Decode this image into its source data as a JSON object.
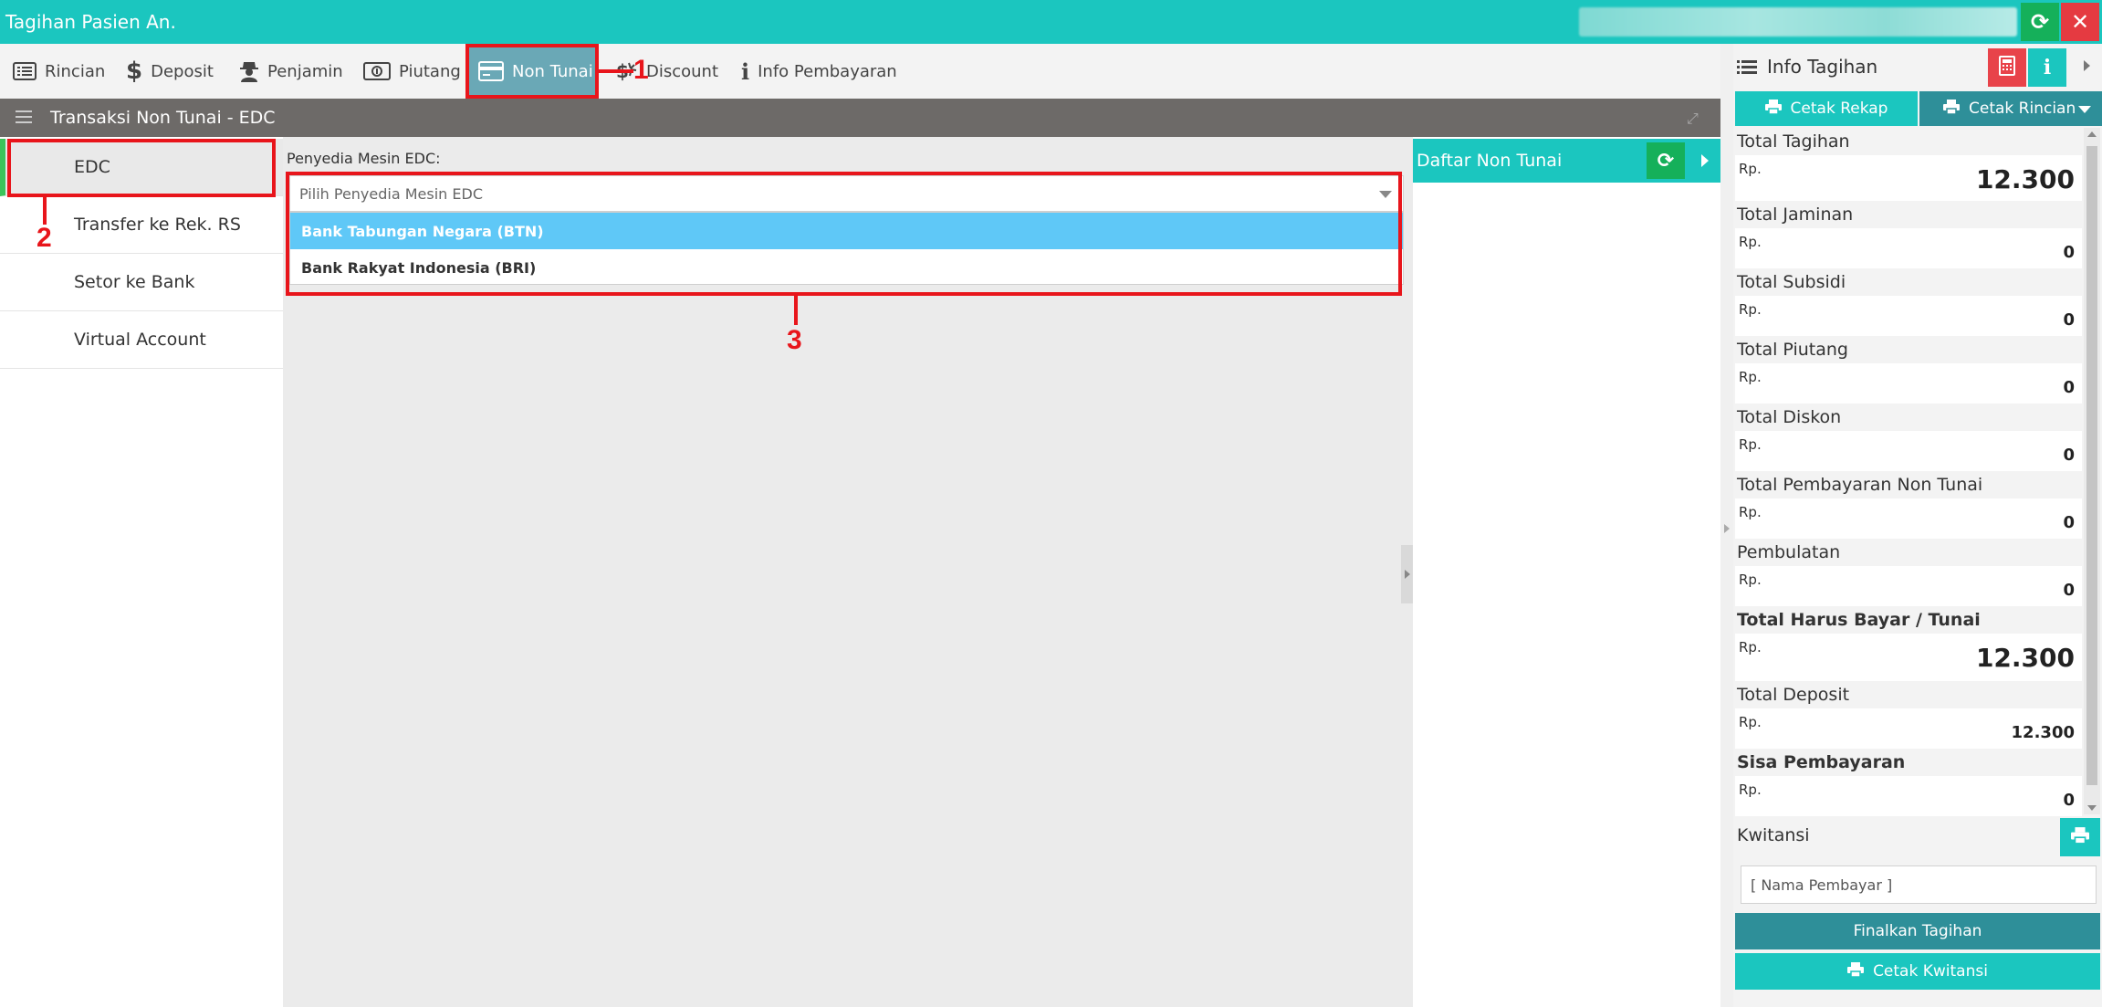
{
  "window": {
    "title": "Tagihan Pasien An."
  },
  "tabs": [
    {
      "label": "Rincian",
      "icon": "list-icon"
    },
    {
      "label": "Deposit",
      "icon": "dollar-icon"
    },
    {
      "label": "Penjamin",
      "icon": "user-secret-icon"
    },
    {
      "label": "Piutang",
      "icon": "money-icon"
    },
    {
      "label": "Non Tunai",
      "icon": "credit-card-icon",
      "active": true
    },
    {
      "label": "Discount",
      "icon": "discount-icon"
    },
    {
      "label": "Info Pembayaran",
      "icon": "info-icon"
    }
  ],
  "section": {
    "title": "Transaksi Non Tunai - EDC"
  },
  "left_menu": [
    {
      "label": "EDC",
      "active": true
    },
    {
      "label": "Transfer ke Rek. RS"
    },
    {
      "label": "Setor ke Bank"
    },
    {
      "label": "Virtual Account"
    }
  ],
  "form": {
    "edc_label": "Penyedia Mesin EDC:",
    "select_placeholder": "Pilih Penyedia Mesin EDC",
    "options": [
      {
        "label": "Bank Tabungan Negara (BTN)",
        "highlighted": true
      },
      {
        "label": "Bank Rakyat Indonesia (BRI)"
      }
    ]
  },
  "daftar": {
    "title": "Daftar Non Tunai"
  },
  "info": {
    "title": "Info Tagihan",
    "cetak_rekap": "Cetak Rekap",
    "cetak_rincian": "Cetak Rincian",
    "currency": "Rp.",
    "summary": [
      {
        "label": "Total Tagihan",
        "value": "12.300",
        "emphasis": "big"
      },
      {
        "label": "Total Jaminan",
        "value": "0"
      },
      {
        "label": "Total Subsidi",
        "value": "0"
      },
      {
        "label": "Total Piutang",
        "value": "0"
      },
      {
        "label": "Total Diskon",
        "value": "0"
      },
      {
        "label": "Total Pembayaran Non Tunai",
        "value": "0"
      },
      {
        "label": "Pembulatan",
        "value": "0"
      },
      {
        "label": "Total Harus Bayar / Tunai",
        "value": "12.300",
        "emphasis": "big",
        "bold_label": true
      },
      {
        "label": "Total Deposit",
        "value": "12.300"
      },
      {
        "label": "Sisa Pembayaran",
        "value": "0",
        "bold_label": true
      }
    ],
    "kwitansi_label": "Kwitansi",
    "nama_pembayar_placeholder": "[ Nama Pembayar ]",
    "finalkan_label": "Finalkan Tagihan",
    "cetak_kwitansi_label": "Cetak Kwitansi"
  },
  "annotations": {
    "n1": "1",
    "n2": "2",
    "n3": "3"
  },
  "colors": {
    "teal": "#1bc6bf",
    "dark_teal": "#2e8f99",
    "green": "#15b05a",
    "red": "#e53a41",
    "highlight": "#5fc8f7",
    "annotation": "#e8151b"
  }
}
